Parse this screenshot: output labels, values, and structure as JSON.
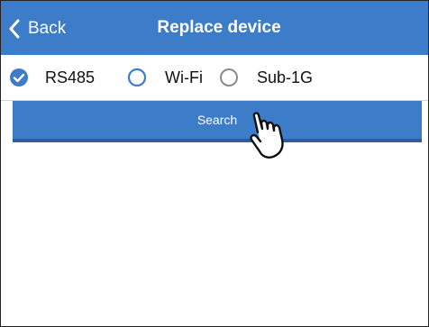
{
  "header": {
    "back_label": "Back",
    "title": "Replace device"
  },
  "options": [
    {
      "label": "RS485",
      "selected": true
    },
    {
      "label": "Wi-Fi",
      "selected": false
    },
    {
      "label": "Sub-1G",
      "selected": false
    }
  ],
  "search": {
    "label": "Search"
  },
  "colors": {
    "accent": "#3d7cc9",
    "radio_selected": "#3d7cc9",
    "radio_unselected": "#8a8a8a"
  }
}
